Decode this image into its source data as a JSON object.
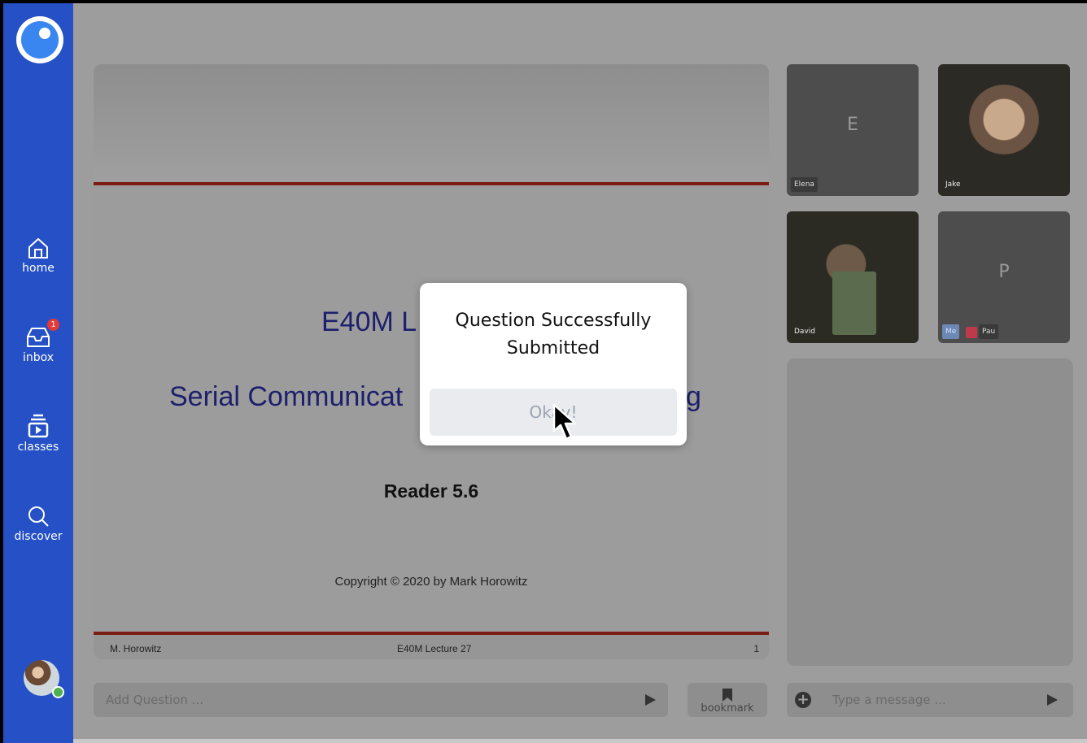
{
  "sidebar": {
    "items": [
      {
        "label": "home",
        "icon": "home-icon"
      },
      {
        "label": "inbox",
        "icon": "inbox-icon",
        "badge": "1"
      },
      {
        "label": "classes",
        "icon": "classes-icon"
      },
      {
        "label": "discover",
        "icon": "search-icon"
      }
    ]
  },
  "slide": {
    "line1_visible": "E40M L",
    "line2_visible": "Serial Communicat",
    "line2_tail": "g",
    "reader": "Reader 5.6",
    "copyright": "Copyright © 2020 by Mark Horowitz",
    "footer_left": "M. Horowitz",
    "footer_center": "E40M Lecture 27",
    "footer_right": "1"
  },
  "participants": [
    {
      "name": "Elena",
      "initial": "E",
      "video": false
    },
    {
      "name": "Jake",
      "video": true
    },
    {
      "name": "David",
      "video": true
    },
    {
      "name": "Pau",
      "initial": "P",
      "video": false,
      "me_label": "Me"
    }
  ],
  "question_input": {
    "placeholder": "Add Question ..."
  },
  "bookmark": {
    "label": "bookmark"
  },
  "message_input": {
    "placeholder": "Type a message ..."
  },
  "modal": {
    "title": "Question Successfully Submitted",
    "button": "Okay!"
  },
  "colors": {
    "sidebar": "#2550c6",
    "overlay": "#9d9d9d",
    "badge": "#e53935",
    "slide_rule": "#7a1d15"
  }
}
